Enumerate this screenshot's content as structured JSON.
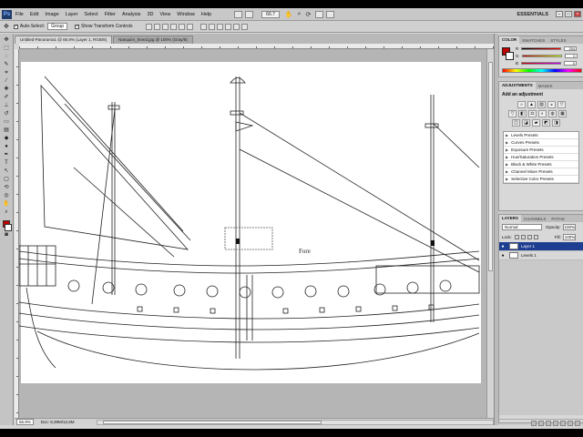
{
  "menu": {
    "logo": "Ps",
    "items": [
      "File",
      "Edit",
      "Image",
      "Layer",
      "Select",
      "Filter",
      "Analysis",
      "3D",
      "View",
      "Window",
      "Help"
    ],
    "zoom": "66.7",
    "workspace": "ESSENTIALS"
  },
  "options": {
    "auto_select_label": "Auto-Select:",
    "auto_select_value": "Group",
    "transform_label": "Show Transform Controls"
  },
  "documents": {
    "tabs": [
      "Untitled-Panorama1 @ 66.9% (Layer 1, RGB/8)",
      "Nanquim_hnerd.jpg @ 100% (Gray/8)"
    ]
  },
  "canvas": {
    "label": "Fore"
  },
  "status": {
    "zoom": "66.9%",
    "doc": "Doc: 8,39M/12,6M"
  },
  "color_panel": {
    "tabs": [
      "COLOR",
      "SWATCHES",
      "STYLES"
    ],
    "rows": [
      {
        "label": "R",
        "value": "204",
        "gradient": "linear-gradient(90deg,#000,#f00)"
      },
      {
        "label": "G",
        "value": "0",
        "gradient": "linear-gradient(90deg,#c00,#cf0)"
      },
      {
        "label": "B",
        "value": "0",
        "gradient": "linear-gradient(90deg,#c00,#c0f)"
      }
    ],
    "foreground": "#c00000",
    "background": "#ffffff"
  },
  "adjustments_panel": {
    "tabs": [
      "ADJUSTMENTS",
      "MASKS"
    ],
    "title": "Add an adjustment",
    "row1": [
      "☼",
      "▲",
      "▧",
      "◒",
      "▽"
    ],
    "row2": [
      "▽",
      "◧",
      "⚖",
      "◐",
      "◍",
      "▦"
    ],
    "row3": [
      "◫",
      "◪",
      "▰",
      "◩",
      "◨"
    ],
    "presets": [
      "Levels Presets",
      "Curves Presets",
      "Exposure Presets",
      "Hue/Saturation Presets",
      "Black & White Presets",
      "Channel Mixer Presets",
      "Selective Color Presets"
    ]
  },
  "layers_panel": {
    "tabs": [
      "LAYERS",
      "CHANNELS",
      "PATHS"
    ],
    "blend_mode": "Normal",
    "opacity_label": "Opacity:",
    "opacity_value": "100%",
    "lock_label": "Lock:",
    "fill_label": "Fill:",
    "fill_value": "100%",
    "layers": [
      {
        "name": "Layer 1",
        "selected": true
      },
      {
        "name": "Levels 1",
        "selected": false
      }
    ]
  }
}
